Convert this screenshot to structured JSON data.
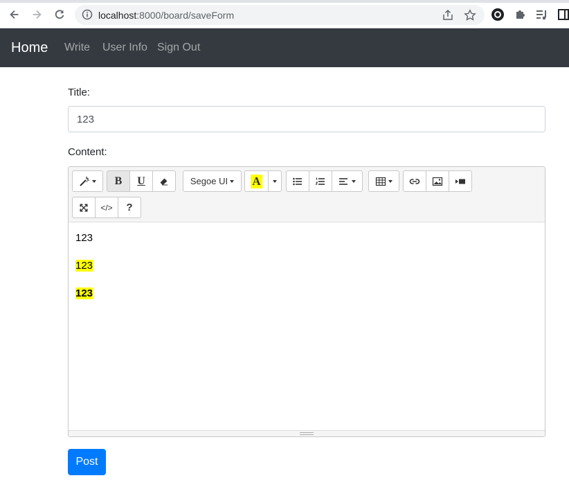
{
  "browser": {
    "url_host": "localhost",
    "url_path": ":8000/board/saveForm"
  },
  "navbar": {
    "brand": "Home",
    "links": [
      "Write",
      "User Info",
      "Sign Out"
    ]
  },
  "form": {
    "title_label": "Title:",
    "title_value": "123",
    "content_label": "Content:",
    "post_label": "Post"
  },
  "toolbar": {
    "font_name": "Segoe UI",
    "bold_glyph": "B",
    "underline_glyph": "U",
    "color_glyph": "A",
    "help_glyph": "?",
    "code_glyph": "</>",
    "highlight_color": "#ffff00"
  },
  "editor": {
    "paragraphs": [
      {
        "text": "123",
        "highlight": false,
        "bold": false
      },
      {
        "text": "123",
        "highlight": true,
        "bold": false
      },
      {
        "text": "123",
        "highlight": true,
        "bold": true
      }
    ]
  },
  "colors": {
    "navbar_bg": "#343a40",
    "primary": "#007bff"
  }
}
